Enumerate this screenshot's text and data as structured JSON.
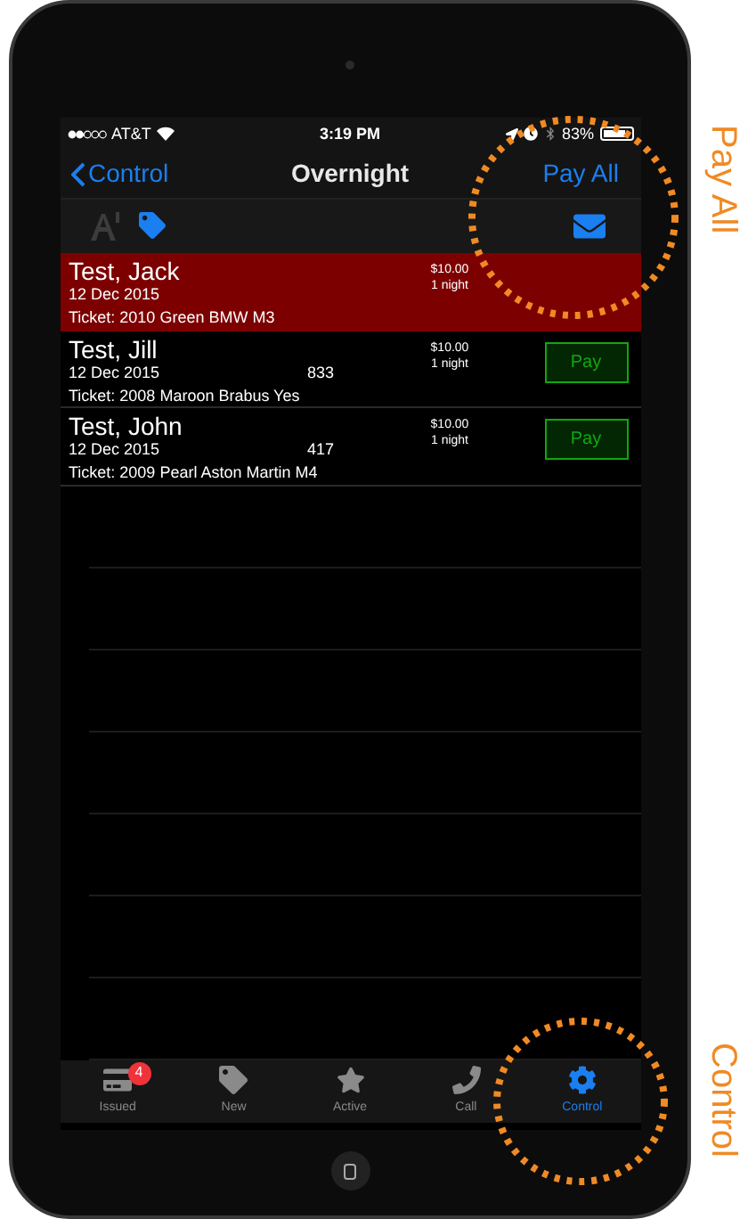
{
  "status_bar": {
    "carrier": "AT&T",
    "time": "3:19 PM",
    "battery": "83%"
  },
  "nav_bar": {
    "back": "Control",
    "title": "Overnight",
    "action": "Pay All"
  },
  "rows": [
    {
      "name": "Test, Jack",
      "date": "12 Dec 2015",
      "ticket": "Ticket: 2010 Green BMW M3",
      "price": "$10.00",
      "duration": "1 night",
      "selected": true
    },
    {
      "name": "Test, Jill",
      "date": "12 Dec 2015",
      "code": "833",
      "ticket": "Ticket: 2008 Maroon Brabus Yes",
      "price": "$10.00",
      "duration": "1 night",
      "selected": false,
      "pay_button": "Pay"
    },
    {
      "name": "Test, John",
      "date": "12 Dec 2015",
      "code": "417",
      "ticket": "Ticket: 2009 Pearl Aston Martin M4",
      "price": "$10.00",
      "duration": "1 night",
      "selected": false,
      "pay_button": "Pay"
    }
  ],
  "tabs": [
    {
      "label": "Issued",
      "selected": false,
      "badge": "4"
    },
    {
      "label": "New",
      "selected": false
    },
    {
      "label": "Active",
      "selected": false
    },
    {
      "label": "Call",
      "selected": false
    },
    {
      "label": "Control",
      "selected": true
    }
  ],
  "annotations": [
    {
      "label": "Pay All"
    },
    {
      "label": "Control"
    }
  ]
}
